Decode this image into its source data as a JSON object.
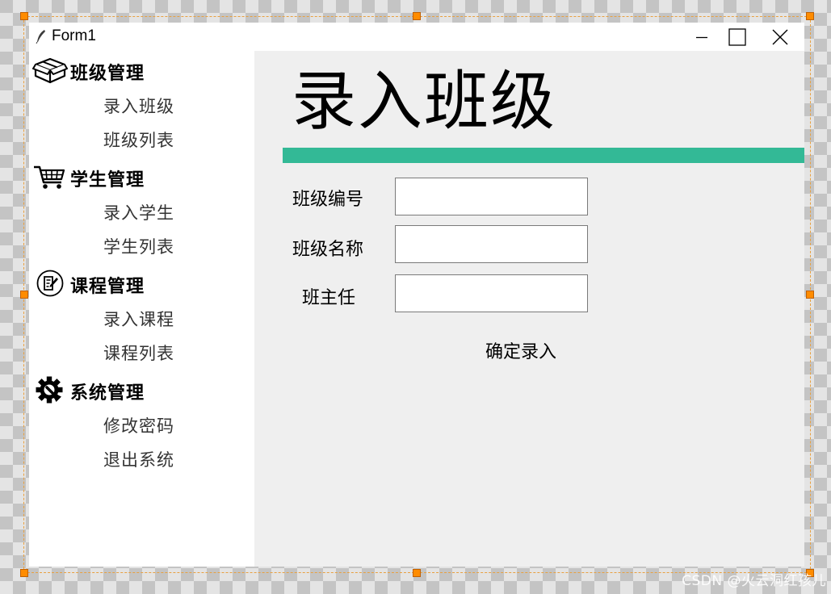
{
  "window": {
    "title": "Form1"
  },
  "sidebar": {
    "categories": [
      {
        "label": "班级管理",
        "icon": "package-icon",
        "items": [
          "录入班级",
          "班级列表"
        ]
      },
      {
        "label": "学生管理",
        "icon": "shopping-cart-icon",
        "items": [
          "录入学生",
          "学生列表"
        ]
      },
      {
        "label": "课程管理",
        "icon": "edit-document-icon",
        "items": [
          "录入课程",
          "课程列表"
        ]
      },
      {
        "label": "系统管理",
        "icon": "gear-wrench-icon",
        "items": [
          "修改密码",
          "退出系统"
        ]
      }
    ]
  },
  "main": {
    "title": "录入班级",
    "form": {
      "fields": [
        {
          "label": "班级编号",
          "value": ""
        },
        {
          "label": "班级名称",
          "value": ""
        },
        {
          "label": "班主任",
          "value": ""
        }
      ],
      "submit_label": "确定录入"
    }
  },
  "colors": {
    "accent": "#33b996",
    "content_bg": "#efefef",
    "handle": "#ff8c00"
  },
  "watermark": "CSDN @火云洞红孩儿"
}
